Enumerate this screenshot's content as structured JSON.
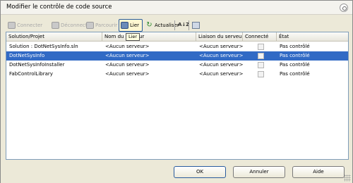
{
  "window": {
    "title": "Modifier le contrôle de code source"
  },
  "toolbar": {
    "connect": "Connecter",
    "disconnect": "Déconnecter",
    "browse": "Parcourir",
    "bind": "Lier",
    "refresh": "Actualiser"
  },
  "tooltip": "Lier",
  "columns": [
    "Solution/Projet",
    "Nom du serveur",
    "Liaison du serveur",
    "Connecté",
    "État"
  ],
  "rows": [
    {
      "project": "Solution : DotNetSysInfo.sln",
      "server": "<Aucun serveur>",
      "binding": "<Aucun serveur>",
      "state": "Pas contrôlé"
    },
    {
      "project": "DotNetSysInfo",
      "server": "<Aucun serveur>",
      "binding": "<Aucun serveur>",
      "state": "Pas contrôlé"
    },
    {
      "project": "DotNetSysInfoInstaller",
      "server": "<Aucun serveur>",
      "binding": "<Aucun serveur>",
      "state": "Pas contrôlé"
    },
    {
      "project": "FabControlLibrary",
      "server": "<Aucun serveur>",
      "binding": "<Aucun serveur>",
      "state": "Pas contrôlé"
    }
  ],
  "buttons": {
    "ok": "OK",
    "cancel": "Annuler",
    "help": "Aide"
  },
  "colors": {
    "selection": "#316ac5",
    "dialog_bg": "#ece9d8"
  }
}
